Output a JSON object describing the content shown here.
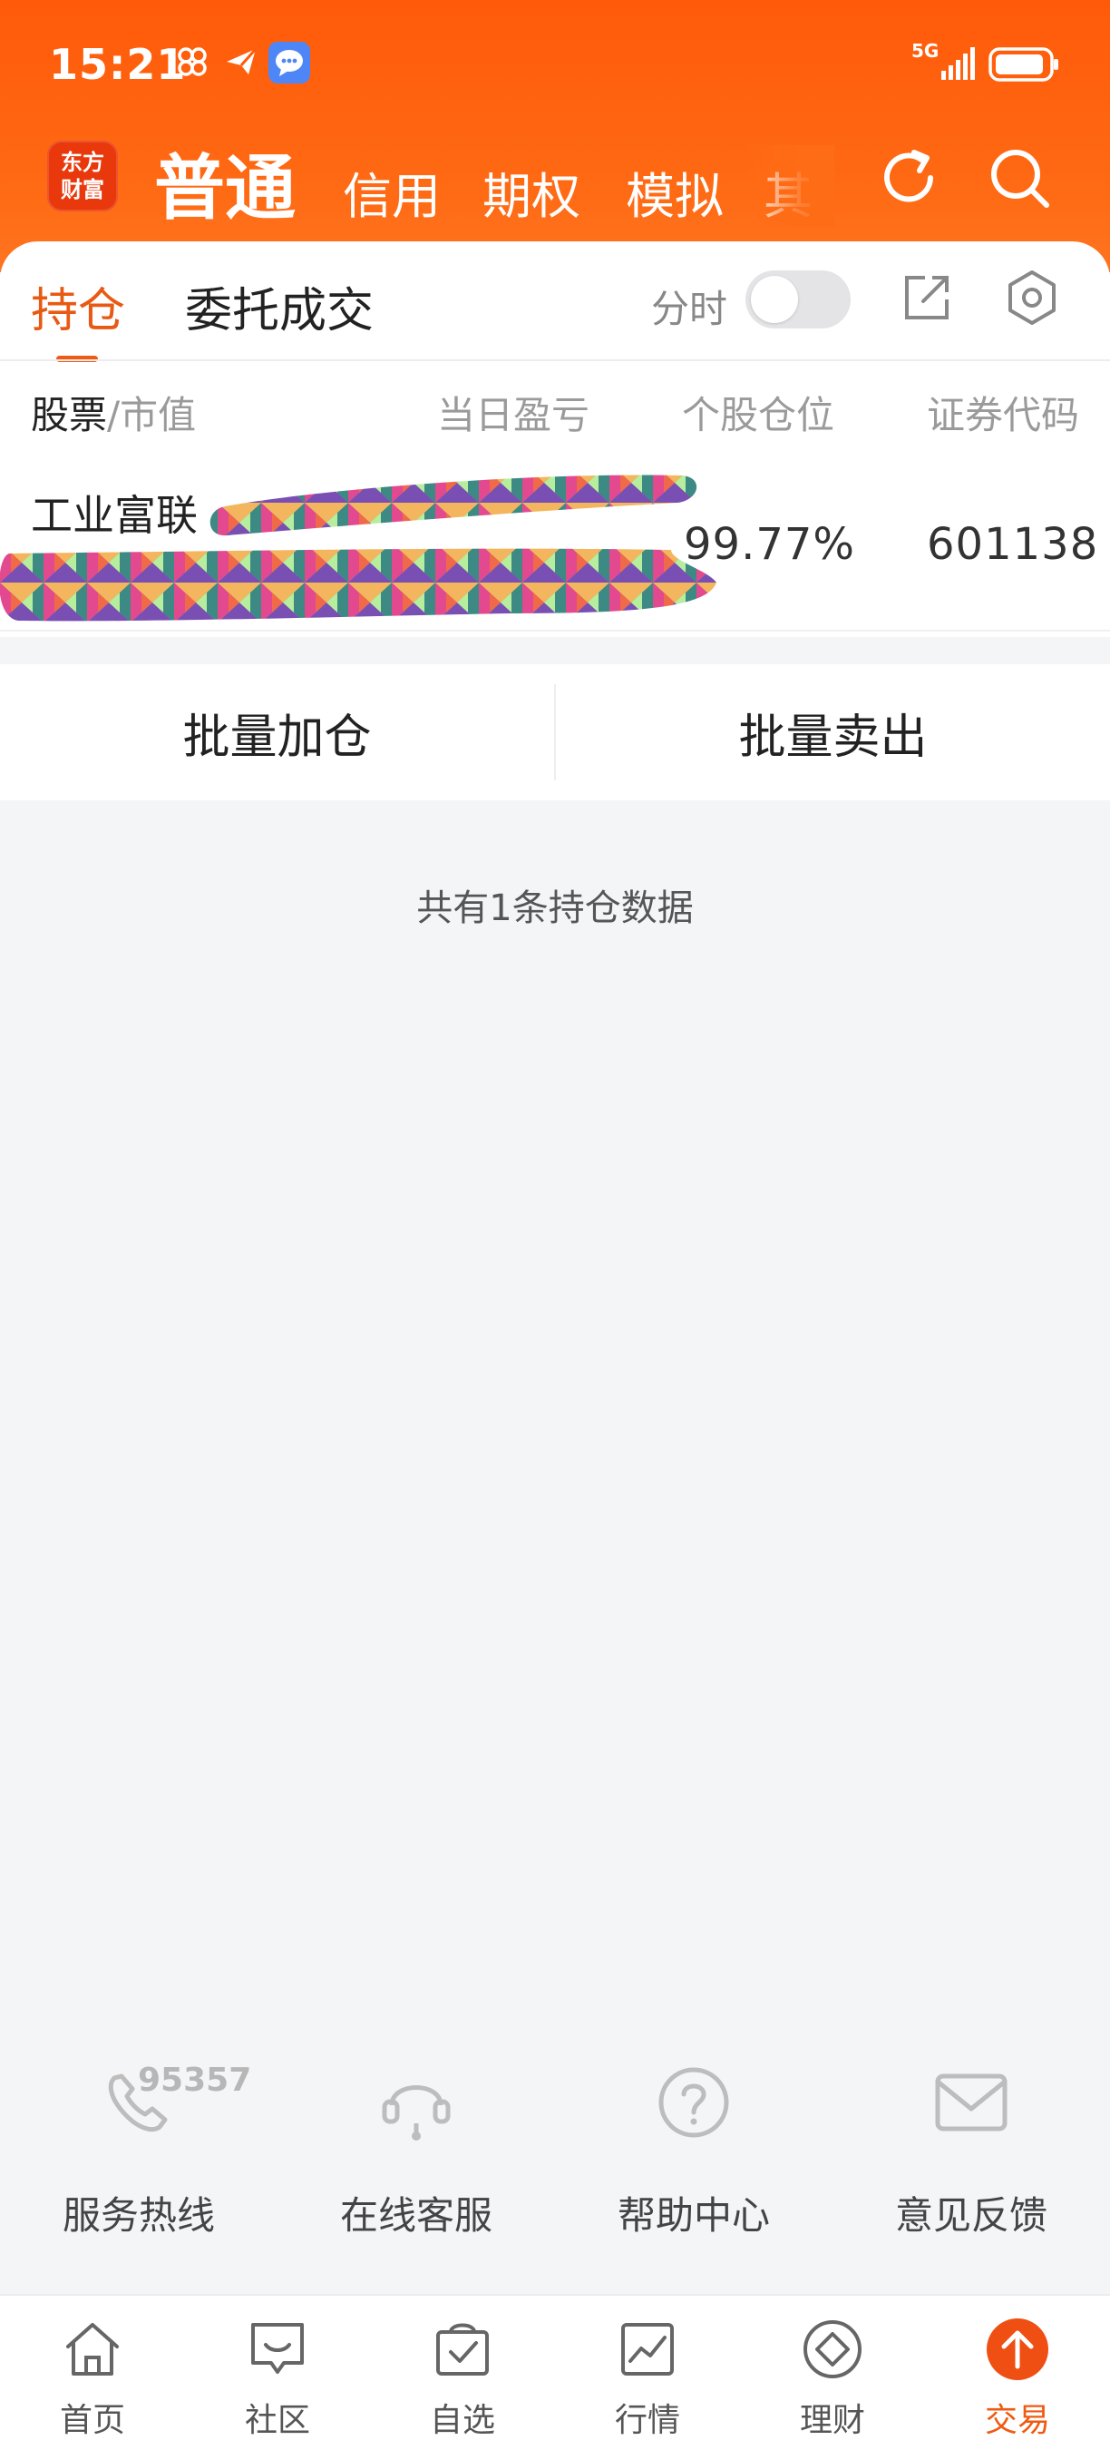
{
  "status_bar": {
    "time": "15:21",
    "network": "5G",
    "icons": [
      "link-app-icon",
      "send-app-icon",
      "message-app-icon",
      "signal-icon",
      "battery-icon"
    ]
  },
  "header": {
    "logo_line1": "东方",
    "logo_line2": "财富",
    "tabs": [
      {
        "label": "普通",
        "active": true
      },
      {
        "label": "信用"
      },
      {
        "label": "期权"
      },
      {
        "label": "模拟"
      },
      {
        "label": "其"
      }
    ],
    "icons": [
      "refresh-icon",
      "search-icon"
    ]
  },
  "segment": {
    "tabs": [
      {
        "label": "持仓",
        "active": true
      },
      {
        "label": "委托成交"
      }
    ],
    "toggle_label": "分时",
    "toggle_on": false,
    "icons": [
      "export-icon",
      "settings-icon"
    ]
  },
  "table": {
    "headers": {
      "stock": "股票",
      "slash_market": "/市值",
      "daily_pl": "当日盈亏",
      "position": "个股仓位",
      "code": "证券代码"
    },
    "rows": [
      {
        "name": "工业富联",
        "position": "99.77%",
        "code": "601138"
      }
    ]
  },
  "batch": {
    "add": "批量加仓",
    "sell": "批量卖出"
  },
  "summary": "共有1条持仓数据",
  "help": {
    "hotline_number": "95357",
    "items": [
      {
        "label": "服务热线",
        "icon": "phone-icon"
      },
      {
        "label": "在线客服",
        "icon": "headset-icon"
      },
      {
        "label": "帮助中心",
        "icon": "help-icon"
      },
      {
        "label": "意见反馈",
        "icon": "mail-icon"
      }
    ]
  },
  "bottom_nav": [
    {
      "label": "首页",
      "icon": "home-icon"
    },
    {
      "label": "社区",
      "icon": "community-icon"
    },
    {
      "label": "自选",
      "icon": "watchlist-icon"
    },
    {
      "label": "行情",
      "icon": "market-icon"
    },
    {
      "label": "理财",
      "icon": "wealth-icon"
    },
    {
      "label": "交易",
      "icon": "trade-icon",
      "active": true
    }
  ],
  "colors": {
    "brand_orange": "#ff5a0a",
    "accent": "#ef5a12"
  }
}
